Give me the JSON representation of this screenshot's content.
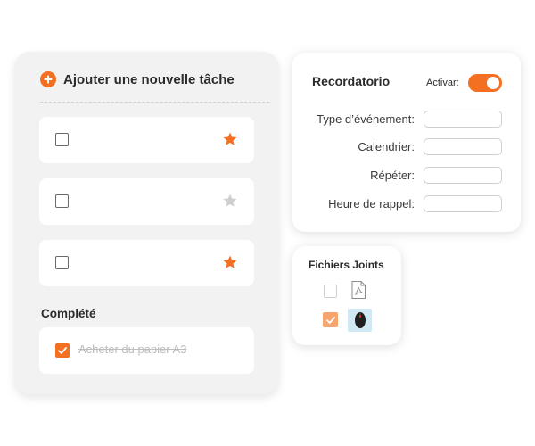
{
  "colors": {
    "accent": "#f36f21",
    "star_inactive": "#cfcfcf",
    "panel_bg": "#f2f2f2"
  },
  "tasks": {
    "add_label": "Ajouter une nouvelle tâche",
    "add_icon": "plus-circle-icon",
    "items": [
      {
        "checked": false,
        "starred": true
      },
      {
        "checked": false,
        "starred": false
      },
      {
        "checked": false,
        "starred": true
      }
    ],
    "completed_heading": "Complété",
    "completed": [
      {
        "label": "Acheter du papier A3",
        "checked": true
      }
    ]
  },
  "reminder": {
    "title": "Recordatorio",
    "activate_label": "Activar:",
    "activate_on": true,
    "fields": [
      {
        "label": "Type d’événement:",
        "value": ""
      },
      {
        "label": "Calendrier:",
        "value": ""
      },
      {
        "label": "Répéter:",
        "value": ""
      },
      {
        "label": "Heure de rappel:",
        "value": ""
      }
    ]
  },
  "attachments": {
    "title": "Fichiers Joints",
    "files": [
      {
        "icon": "pdf-file-icon",
        "checked": false
      },
      {
        "icon": "mouse-image-thumbnail",
        "checked": true
      }
    ]
  }
}
